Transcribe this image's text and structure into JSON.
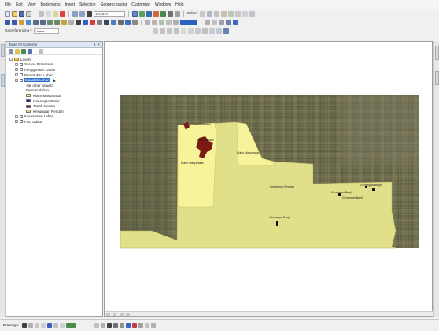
{
  "menu": [
    "File",
    "Edit",
    "View",
    "Bookmarks",
    "Insert",
    "Selection",
    "Geoprocessing",
    "Customize",
    "Windows",
    "Help"
  ],
  "toolbar": {
    "scale_value": "1:37,819",
    "editor_label": "Editor▾",
    "georef_label": "Georeferencing ▾",
    "layer_label": "Layers"
  },
  "toc": {
    "title": "Table Of Contents",
    "close_label": "✕",
    "pin_label": "⊼",
    "rows": [
      {
        "indent": 0,
        "pm": "−",
        "kind": "folder",
        "label": "Layers"
      },
      {
        "indent": 1,
        "pm": "+",
        "kind": "checkbox",
        "checked": false,
        "label": "Sarana Prasarana"
      },
      {
        "indent": 1,
        "pm": "+",
        "kind": "checkbox",
        "checked": false,
        "label": "Penggunaan Lahan"
      },
      {
        "indent": 1,
        "pm": "+",
        "kind": "checkbox",
        "checked": false,
        "label": "Peruntukan Lahan"
      },
      {
        "indent": 1,
        "pm": "−",
        "kind": "checkbox",
        "checked": true,
        "label": "Masalah Lahan",
        "selected": true
      },
      {
        "indent": 3,
        "pm": "",
        "kind": "text",
        "label": "<all other values>"
      },
      {
        "indent": 3,
        "pm": "",
        "kind": "text",
        "label": "Permasalahan"
      },
      {
        "indent": 3,
        "pm": "",
        "kind": "swatch",
        "color": "#f5f09a",
        "label": "Klaim Masyarakat"
      },
      {
        "indent": 3,
        "pm": "",
        "kind": "swatch",
        "color": "#1a2a8a",
        "label": "Genangan Banjir"
      },
      {
        "indent": 3,
        "pm": "",
        "kind": "swatch",
        "color": "#7a1a1a",
        "label": "Tanah Masam"
      },
      {
        "indent": 3,
        "pm": "",
        "kind": "swatch",
        "color": "#d8d870",
        "label": "Kesuburan Rendah"
      },
      {
        "indent": 1,
        "pm": "+",
        "kind": "checkbox",
        "checked": false,
        "label": "Kesesuaian Lahan"
      },
      {
        "indent": 1,
        "pm": "+",
        "kind": "checkbox",
        "checked": true,
        "label": "Foto Udara"
      }
    ]
  },
  "map": {
    "labels": [
      {
        "text": "Tanah Masam",
        "cls": "lbl-1"
      },
      {
        "text": "Tanah Masam",
        "cls": "lbl-2"
      },
      {
        "text": "Klaim Masyarakat",
        "cls": "lbl-3"
      },
      {
        "text": "Klaim Masyarakat",
        "cls": "lbl-4"
      },
      {
        "text": "Kesuburan Rendah",
        "cls": "lbl-5"
      },
      {
        "text": "Genangan Banjir",
        "cls": "lbl-6"
      },
      {
        "text": "Genangan Banjir",
        "cls": "lbl-7"
      },
      {
        "text": "Genangan Banjir",
        "cls": "lbl-8"
      },
      {
        "text": "Genangan Banjir",
        "cls": "lbl-9"
      }
    ],
    "colors": {
      "imagery": "#6b6a4c",
      "kesuburan": "#e0df8a",
      "klaim": "#f7f39a",
      "masam": "#7a1a12",
      "banjir": "#111111"
    }
  },
  "status": {
    "drawing_label": "Drawing ▾"
  }
}
